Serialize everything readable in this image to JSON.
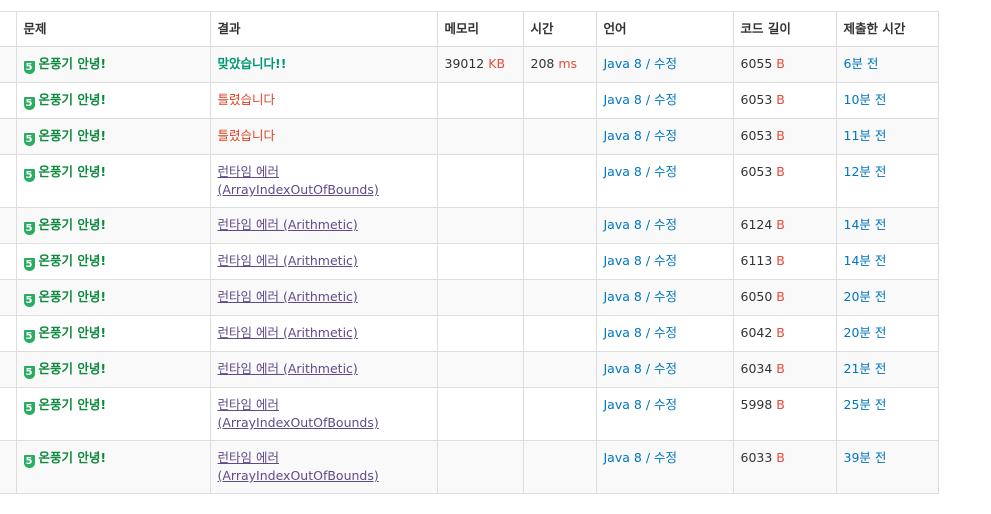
{
  "headers": {
    "id": "",
    "problem": "문제",
    "result": "결과",
    "memory": "메모리",
    "time": "시간",
    "language": "언어",
    "code_length": "코드 길이",
    "submitted": "제출한 시간"
  },
  "rows": [
    {
      "tier": "5",
      "problem": "온풍기 안녕!",
      "result": "맞았습니다!!",
      "result_type": "ac",
      "memory": "39012",
      "memory_unit": "KB",
      "time": "208",
      "time_unit": "ms",
      "lang": "Java 8",
      "sep": " / ",
      "edit": "수정",
      "length": "6055",
      "length_unit": "B",
      "submitted": "6분 전"
    },
    {
      "tier": "5",
      "problem": "온풍기 안녕!",
      "result": "틀렸습니다",
      "result_type": "wa",
      "memory": "",
      "memory_unit": "",
      "time": "",
      "time_unit": "",
      "lang": "Java 8",
      "sep": " / ",
      "edit": "수정",
      "length": "6053",
      "length_unit": "B",
      "submitted": "10분 전"
    },
    {
      "tier": "5",
      "problem": "온풍기 안녕!",
      "result": "틀렸습니다",
      "result_type": "wa",
      "memory": "",
      "memory_unit": "",
      "time": "",
      "time_unit": "",
      "lang": "Java 8",
      "sep": " / ",
      "edit": "수정",
      "length": "6053",
      "length_unit": "B",
      "submitted": "11분 전"
    },
    {
      "tier": "5",
      "problem": "온풍기 안녕!",
      "result": "런타임 에러 (ArrayIndexOutOfBounds)",
      "result_type": "rte",
      "memory": "",
      "memory_unit": "",
      "time": "",
      "time_unit": "",
      "lang": "Java 8",
      "sep": " / ",
      "edit": "수정",
      "length": "6053",
      "length_unit": "B",
      "submitted": "12분 전"
    },
    {
      "tier": "5",
      "problem": "온풍기 안녕!",
      "result": "런타임 에러 (Arithmetic)",
      "result_type": "rte",
      "memory": "",
      "memory_unit": "",
      "time": "",
      "time_unit": "",
      "lang": "Java 8",
      "sep": " / ",
      "edit": "수정",
      "length": "6124",
      "length_unit": "B",
      "submitted": "14분 전"
    },
    {
      "tier": "5",
      "problem": "온풍기 안녕!",
      "result": "런타임 에러 (Arithmetic)",
      "result_type": "rte",
      "memory": "",
      "memory_unit": "",
      "time": "",
      "time_unit": "",
      "lang": "Java 8",
      "sep": " / ",
      "edit": "수정",
      "length": "6113",
      "length_unit": "B",
      "submitted": "14분 전"
    },
    {
      "tier": "5",
      "problem": "온풍기 안녕!",
      "result": "런타임 에러 (Arithmetic)",
      "result_type": "rte",
      "memory": "",
      "memory_unit": "",
      "time": "",
      "time_unit": "",
      "lang": "Java 8",
      "sep": " / ",
      "edit": "수정",
      "length": "6050",
      "length_unit": "B",
      "submitted": "20분 전"
    },
    {
      "tier": "5",
      "problem": "온풍기 안녕!",
      "result": "런타임 에러 (Arithmetic)",
      "result_type": "rte",
      "memory": "",
      "memory_unit": "",
      "time": "",
      "time_unit": "",
      "lang": "Java 8",
      "sep": " / ",
      "edit": "수정",
      "length": "6042",
      "length_unit": "B",
      "submitted": "20분 전"
    },
    {
      "tier": "5",
      "problem": "온풍기 안녕!",
      "result": "런타임 에러 (Arithmetic)",
      "result_type": "rte",
      "memory": "",
      "memory_unit": "",
      "time": "",
      "time_unit": "",
      "lang": "Java 8",
      "sep": " / ",
      "edit": "수정",
      "length": "6034",
      "length_unit": "B",
      "submitted": "21분 전"
    },
    {
      "tier": "5",
      "problem": "온풍기 안녕!",
      "result": "런타임 에러 (ArrayIndexOutOfBounds)",
      "result_type": "rte",
      "memory": "",
      "memory_unit": "",
      "time": "",
      "time_unit": "",
      "lang": "Java 8",
      "sep": " / ",
      "edit": "수정",
      "length": "5998",
      "length_unit": "B",
      "submitted": "25분 전"
    },
    {
      "tier": "5",
      "problem": "온풍기 안녕!",
      "result": "런타임 에러 (ArrayIndexOutOfBounds)",
      "result_type": "rte",
      "memory": "",
      "memory_unit": "",
      "time": "",
      "time_unit": "",
      "lang": "Java 8",
      "sep": " / ",
      "edit": "수정",
      "length": "6033",
      "length_unit": "B",
      "submitted": "39분 전"
    }
  ],
  "colors": {
    "accepted": "#009874",
    "wrong": "#dd4124",
    "runtime_error": "#5f4b8b",
    "link": "#0076c0",
    "unit": "#e74c3c",
    "tier_badge": "#27ae60"
  },
  "icons": {
    "tier_badge": "tier-shield-icon"
  }
}
